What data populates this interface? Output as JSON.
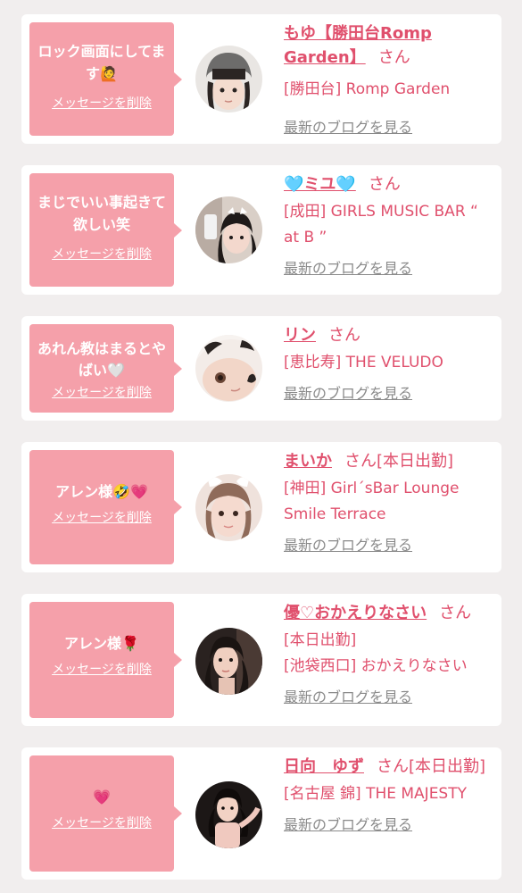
{
  "delete_label": "メッセージを削除",
  "blog_label": "最新のブログを見る",
  "san_label": "さん",
  "items": [
    {
      "message": "ロック画面にしてます🙋",
      "name": "もゆ【勝田台Romp Garden】",
      "badge": "",
      "shop": "[勝田台] Romp Garden"
    },
    {
      "message": "まじでいい事起きて欲しい笑",
      "name": "🩵ミユ🩵",
      "badge": "",
      "shop": "[成田] GIRLS MUSIC BAR “ at B ”"
    },
    {
      "message": "あれん教はまるとやばい🤍",
      "name": "リン",
      "badge": "",
      "shop": "[恵比寿] THE VELUDO"
    },
    {
      "message": "アレン様🤣💗",
      "name": "まいか",
      "badge": "[本日出勤]",
      "shop": "[神田] Girl´sBar Lounge Smile Terrace"
    },
    {
      "message": "アレン様🌹",
      "name": "優♡おかえりなさい",
      "badge": "",
      "shop": "[本日出勤]\n[池袋西口] おかえりなさい"
    },
    {
      "message": "💗",
      "name": "日向　ゆず",
      "badge": "[本日出勤]",
      "shop": "[名古屋 錦] THE MAJESTY"
    }
  ]
}
